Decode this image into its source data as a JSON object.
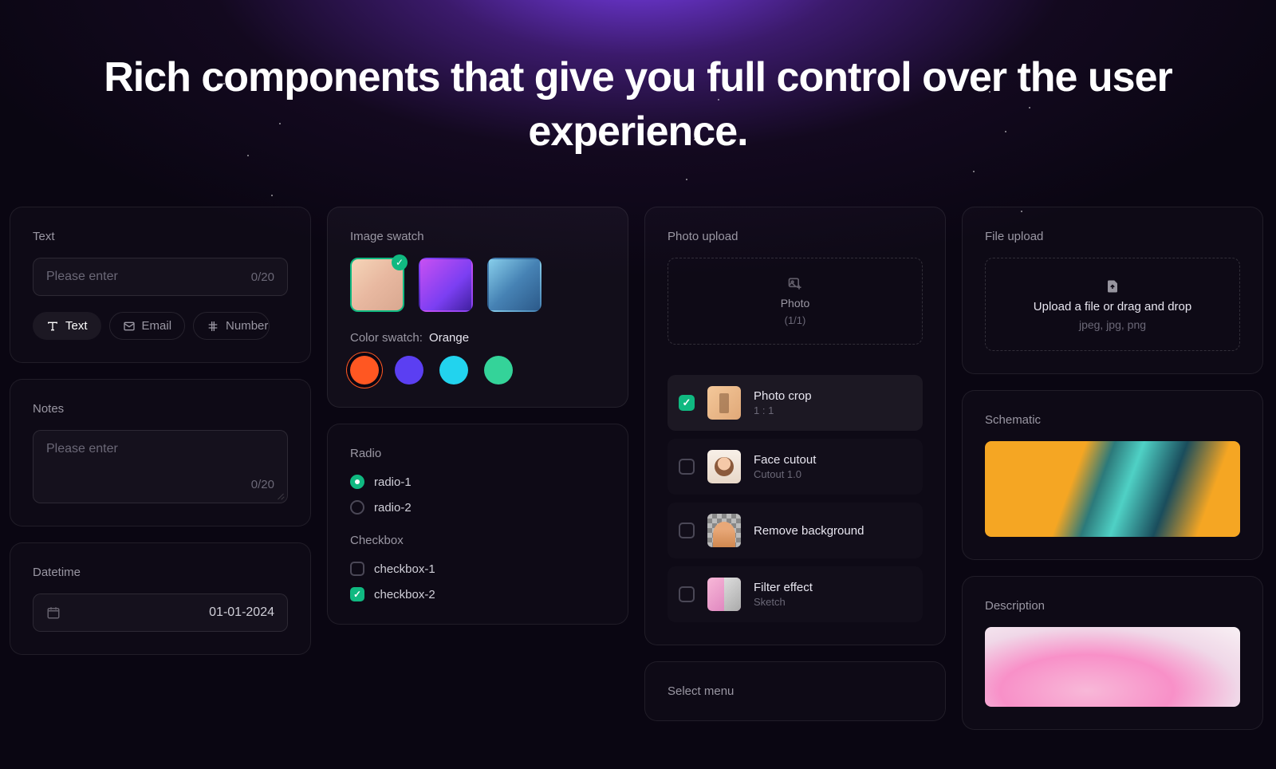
{
  "headline": "Rich components that give you full control over the user experience.",
  "text_card": {
    "label": "Text",
    "placeholder": "Please enter",
    "counter": "0/20",
    "tabs": [
      {
        "label": "Text",
        "icon": "text-icon"
      },
      {
        "label": "Email",
        "icon": "email-icon"
      },
      {
        "label": "Number",
        "icon": "number-icon"
      }
    ]
  },
  "notes_card": {
    "label": "Notes",
    "placeholder": "Please enter",
    "counter": "0/20"
  },
  "datetime_card": {
    "label": "Datetime",
    "value": "01-01-2024"
  },
  "image_swatch_card": {
    "label": "Image swatch",
    "cs_prefix": "Color swatch:",
    "cs_value": "Orange"
  },
  "radio_card": {
    "radio_label": "Radio",
    "radio_opts": [
      "radio-1",
      "radio-2"
    ],
    "checkbox_label": "Checkbox",
    "checkbox_opts": [
      "checkbox-1",
      "checkbox-2"
    ]
  },
  "photo_card": {
    "label": "Photo upload",
    "zone_title": "Photo",
    "zone_sub": "(1/1)",
    "items": [
      {
        "title": "Photo crop",
        "sub": "1 : 1",
        "checked": true
      },
      {
        "title": "Face cutout",
        "sub": "Cutout 1.0",
        "checked": false
      },
      {
        "title": "Remove background",
        "sub": "",
        "checked": false
      },
      {
        "title": "Filter effect",
        "sub": "Sketch",
        "checked": false
      }
    ]
  },
  "select_card": {
    "label": "Select menu"
  },
  "file_card": {
    "label": "File upload",
    "zone_title": "Upload a file or drag and drop",
    "zone_sub": "jpeg, jpg, png"
  },
  "schematic_card": {
    "label": "Schematic"
  },
  "description_card": {
    "label": "Description"
  }
}
